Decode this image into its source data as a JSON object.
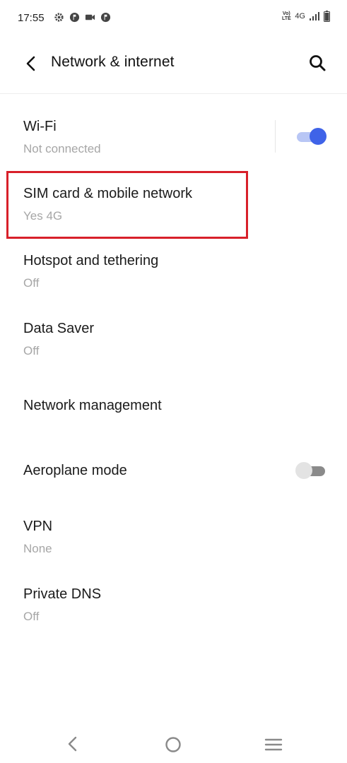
{
  "status_bar": {
    "time": "17:55",
    "volte_line1": "Vo)",
    "volte_line2": "LTE",
    "network_type": "4G",
    "icons_left": [
      "settings-gear-icon",
      "notification-icon",
      "video-record-icon",
      "notification-icon"
    ],
    "icons_right": [
      "volte-icon",
      "signal-icon",
      "battery-icon"
    ]
  },
  "header": {
    "title": "Network & internet",
    "back_icon": "back-arrow-icon",
    "search_icon": "search-icon"
  },
  "items": [
    {
      "title": "Wi-Fi",
      "subtitle": "Not connected",
      "toggle": true
    },
    {
      "title": "SIM card & mobile network",
      "subtitle": "Yes 4G"
    },
    {
      "title": "Hotspot and tethering",
      "subtitle": "Off"
    },
    {
      "title": "Data Saver",
      "subtitle": "Off"
    },
    {
      "title": "Network management"
    },
    {
      "title": "Aeroplane mode",
      "toggle": false
    },
    {
      "title": "VPN",
      "subtitle": "None"
    },
    {
      "title": "Private DNS",
      "subtitle": "Off"
    }
  ],
  "colors": {
    "accent": "#3f63e8",
    "accent_track": "#b8c6f5",
    "highlight": "#d8202a",
    "subtitle": "#a6a6a6",
    "toggle_off_thumb": "#e3e3e3",
    "toggle_off_track": "#8a8a8a"
  },
  "nav_bar": {
    "icons": [
      "nav-back-icon",
      "nav-home-icon",
      "nav-menu-icon"
    ]
  }
}
